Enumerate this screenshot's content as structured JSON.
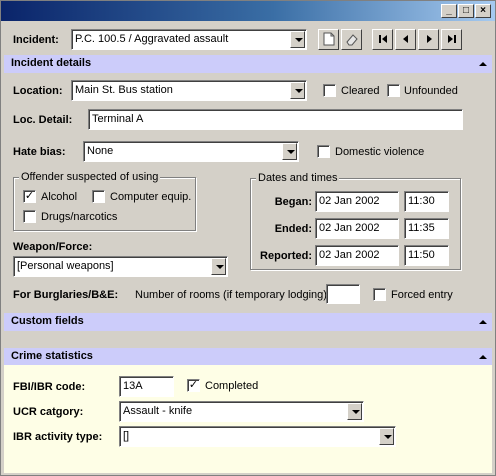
{
  "window": {
    "minimize": "_",
    "maximize": "□",
    "close": "×"
  },
  "incident": {
    "label": "Incident:",
    "value": "P.C. 100.5 / Aggravated assault"
  },
  "sections": {
    "incident_details": "Incident details",
    "custom_fields": "Custom fields",
    "crime_statistics": "Crime statistics"
  },
  "location": {
    "label": "Location:",
    "value": "Main St. Bus station",
    "cleared": "Cleared",
    "unfounded": "Unfounded"
  },
  "loc_detail": {
    "label": "Loc. Detail:",
    "value": "Terminal A"
  },
  "hate_bias": {
    "label": "Hate bias:",
    "value": "None",
    "domestic": "Domestic violence"
  },
  "offender": {
    "title": "Offender suspected of using",
    "alcohol": "Alcohol",
    "alcohol_checked": true,
    "computer": "Computer equip.",
    "drugs": "Drugs/narcotics"
  },
  "dates": {
    "title": "Dates and times",
    "began_label": "Began:",
    "began_date": "02 Jan 2002",
    "began_time": "11:30",
    "ended_label": "Ended:",
    "ended_date": "02 Jan 2002",
    "ended_time": "11:35",
    "reported_label": "Reported:",
    "reported_date": "02 Jan 2002",
    "reported_time": "11:50"
  },
  "weapon": {
    "label": "Weapon/Force:",
    "value": "[Personal weapons]"
  },
  "burglary": {
    "label": "For Burglaries/B&E:",
    "rooms_label": "Number of rooms (if temporary lodging):",
    "rooms_value": "",
    "forced_entry": "Forced entry"
  },
  "crime": {
    "fbi_label": "FBI/IBR code:",
    "fbi_value": "13A",
    "completed": "Completed",
    "completed_checked": true,
    "ucr_label": "UCR catgory:",
    "ucr_value": "Assault - knife",
    "ibr_label": "IBR activity type:",
    "ibr_value": "[]"
  },
  "icons": {
    "new": "new-document-icon",
    "edit": "eraser-icon",
    "first": "first-record-icon",
    "prev": "previous-record-icon",
    "next": "next-record-icon",
    "last": "last-record-icon"
  },
  "colors": {
    "section_header": "#ccccfa",
    "statistics_bg": "#fefee6",
    "title_bar": "#0a246a"
  }
}
